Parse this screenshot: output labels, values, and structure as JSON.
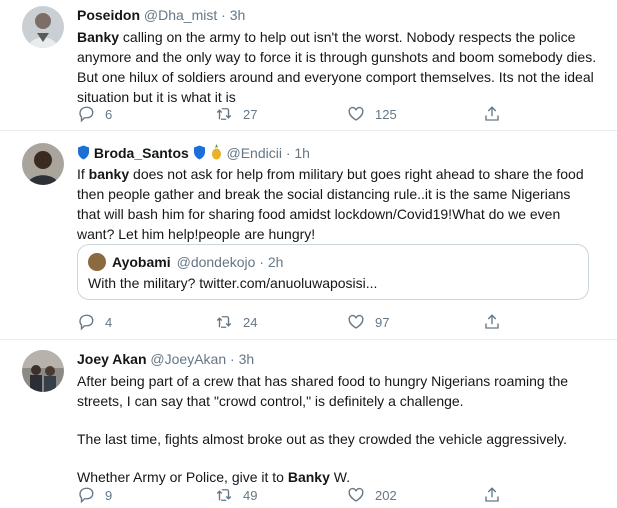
{
  "tweets": [
    {
      "name": "Poseidon",
      "handle": "@Dha_mist",
      "time": "3h",
      "text_bold": "Banky",
      "text_rest": " calling on the army to help out isn't the worst. Nobody respects the police anymore and the only way to force it is through gunshots and boom somebody dies. But one hilux of soldiers around and everyone comport themselves. Its not the ideal situation but it is what it is",
      "replies": "6",
      "retweets": "27",
      "likes": "125"
    },
    {
      "name": "Broda_Santos",
      "handle": "@Endicii",
      "time": "1h",
      "text_pre": "If ",
      "text_bold": "banky",
      "text_rest": " does not ask for help from military but goes right ahead to share the food then people gather and break the social distancing rule..it is the same Nigerians that will bash him for sharing food amidst lockdown/Covid19!What do we even want? Let him help!people are hungry!",
      "quote": {
        "name": "Ayobami",
        "handle": "@dondekojo",
        "time": "2h",
        "text": "With the military? twitter.com/anuoluwaposisi..."
      },
      "replies": "4",
      "retweets": "24",
      "likes": "97"
    },
    {
      "name": "Joey Akan",
      "handle": "@JoeyAkan",
      "time": "3h",
      "para1": "After being part of a crew that has shared food to hungry Nigerians roaming the streets, I can say that \"crowd control,\" is definitely a challenge.",
      "para2": "The last time, fights almost broke out as they crowded the vehicle aggressively.",
      "para3_pre": "Whether Army or Police, give it to ",
      "para3_bold": "Banky",
      "para3_rest": " W.",
      "replies": "9",
      "retweets": "49",
      "likes": "202"
    }
  ],
  "separator": " · ",
  "colors": {
    "text": "#14171a",
    "secondary": "#657786",
    "border": "#e6ecf0",
    "shield": "#1d6fd6"
  },
  "icons": [
    "reply-icon",
    "retweet-icon",
    "like-icon",
    "share-icon",
    "shield-icon",
    "pineapple-icon"
  ]
}
